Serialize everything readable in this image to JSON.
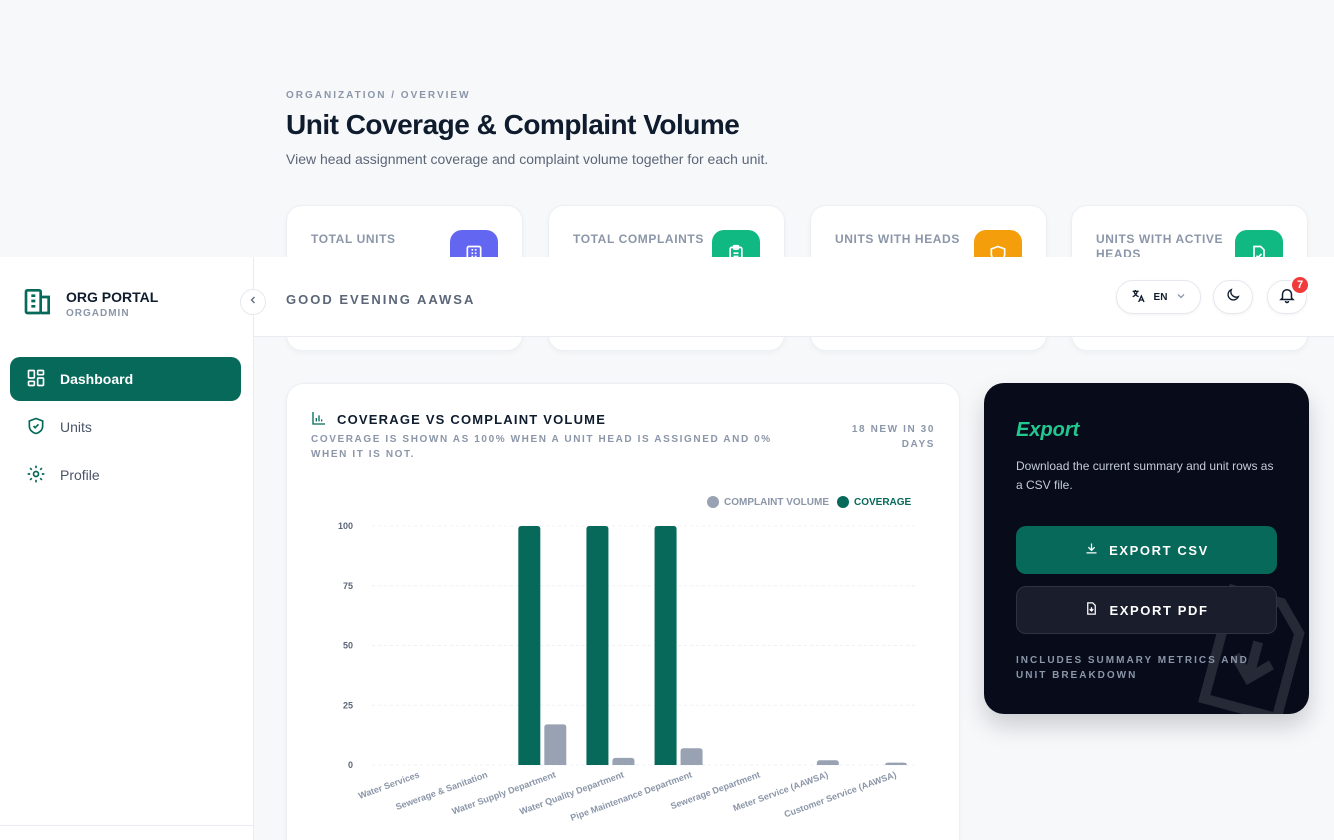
{
  "page": {
    "breadcrumb": "ORGANIZATION / OVERVIEW",
    "title": "Unit Coverage & Complaint Volume",
    "subtitle": "View head assignment coverage and complaint volume together for each unit."
  },
  "stats": [
    {
      "label": "TOTAL UNITS",
      "icon": "building-icon",
      "color": "#6366f1"
    },
    {
      "label": "TOTAL COMPLAINTS",
      "icon": "clipboard-icon",
      "color": "#10b981"
    },
    {
      "label": "UNITS WITH HEADS",
      "icon": "shield-icon",
      "color": "#f59e0b"
    },
    {
      "label": "UNITS WITH ACTIVE HEADS",
      "icon": "file-check-icon",
      "color": "#10b981"
    }
  ],
  "sidebar": {
    "brand_title": "ORG PORTAL",
    "brand_sub": "ORGADMIN",
    "items": [
      {
        "label": "Dashboard",
        "icon": "dashboard-icon",
        "active": true
      },
      {
        "label": "Units",
        "icon": "shield-icon",
        "active": false
      },
      {
        "label": "Profile",
        "icon": "gear-icon",
        "active": false
      }
    ]
  },
  "topbar": {
    "greeting": "GOOD EVENING AAWSA",
    "language": "EN",
    "notification_count": "7"
  },
  "chart_card": {
    "title": "COVERAGE VS COMPLAINT VOLUME",
    "subtitle": "COVERAGE IS SHOWN AS 100% WHEN A UNIT HEAD IS ASSIGNED AND 0% WHEN IT IS NOT.",
    "badge": "18 NEW IN 30 DAYS"
  },
  "chart_data": {
    "type": "bar",
    "categories": [
      "Water Services",
      "Sewerage & Sanitation",
      "Water Supply Department",
      "Water Quality Department",
      "Pipe Maintenance Department",
      "Sewerage Department",
      "Meter Service (AAWSA)",
      "Customer Service (AAWSA)"
    ],
    "series": [
      {
        "name": "COVERAGE",
        "color": "#06695a",
        "values": [
          0,
          0,
          100,
          100,
          100,
          0,
          0,
          0
        ]
      },
      {
        "name": "COMPLAINT VOLUME",
        "color": "#98a2b3",
        "values": [
          0,
          0,
          17,
          3,
          7,
          0,
          2,
          1
        ]
      }
    ],
    "legend_order": [
      "COMPLAINT VOLUME",
      "COVERAGE"
    ],
    "legend_position": "top-right",
    "yticks": [
      "0",
      "25",
      "50",
      "75",
      "100"
    ],
    "ylim": [
      0,
      100
    ],
    "grid": true
  },
  "export": {
    "title": "Export",
    "description": "Download the current summary and unit rows as a CSV file.",
    "csv_label": "EXPORT CSV",
    "pdf_label": "EXPORT PDF",
    "note": "INCLUDES SUMMARY METRICS AND UNIT BREAKDOWN"
  }
}
